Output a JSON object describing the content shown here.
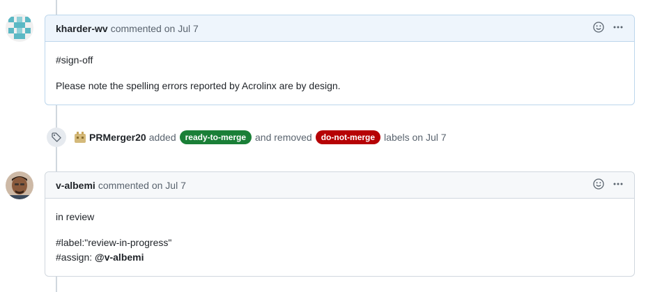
{
  "comment1": {
    "author": "kharder-wv",
    "meta": "commented on Jul 7",
    "body": [
      "#sign-off",
      "Please note the spelling errors reported by Acrolinx are by design."
    ]
  },
  "event": {
    "actor": "PRMerger20",
    "added_text": "added",
    "added_label": "ready-to-merge",
    "added_label_color": "#1a7f37",
    "removed_text": "and removed",
    "removed_label": "do-not-merge",
    "removed_label_color": "#b60205",
    "suffix": "labels on Jul 7"
  },
  "comment2": {
    "author": "v-albemi",
    "meta": "commented on Jul 7",
    "body_line1": "in review",
    "body_line2": "#label:\"review-in-progress\"",
    "body_line3_prefix": "#assign:",
    "body_line3_mention": "@v-albemi"
  },
  "icons": {
    "reaction": "smiley-icon",
    "more": "kebab-horizontal-icon",
    "label_event": "tag-icon"
  }
}
